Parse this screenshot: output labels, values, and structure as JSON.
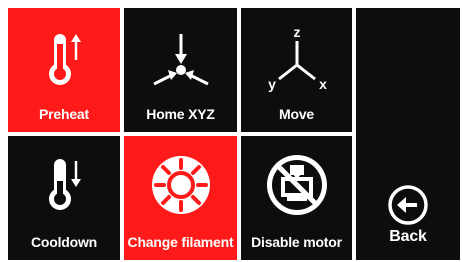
{
  "menu": {
    "items": [
      {
        "label": "Preheat",
        "icon": "thermometer-up-icon"
      },
      {
        "label": "Home XYZ",
        "icon": "home-axes-icon"
      },
      {
        "label": "Move",
        "icon": "xyz-axes-icon"
      },
      {
        "label": "Cooldown",
        "icon": "thermometer-down-icon"
      },
      {
        "label": "Change filament",
        "icon": "filament-change-icon"
      },
      {
        "label": "Disable motor",
        "icon": "disable-motor-icon"
      }
    ],
    "back": {
      "label": "Back",
      "icon": "back-arrow-icon"
    },
    "axis_labels": {
      "z": "z",
      "y": "y",
      "x": "x"
    }
  },
  "colors": {
    "tile_bg": "#0d0d0d",
    "active_bg": "#ff1a1a",
    "text": "#ffffff"
  }
}
